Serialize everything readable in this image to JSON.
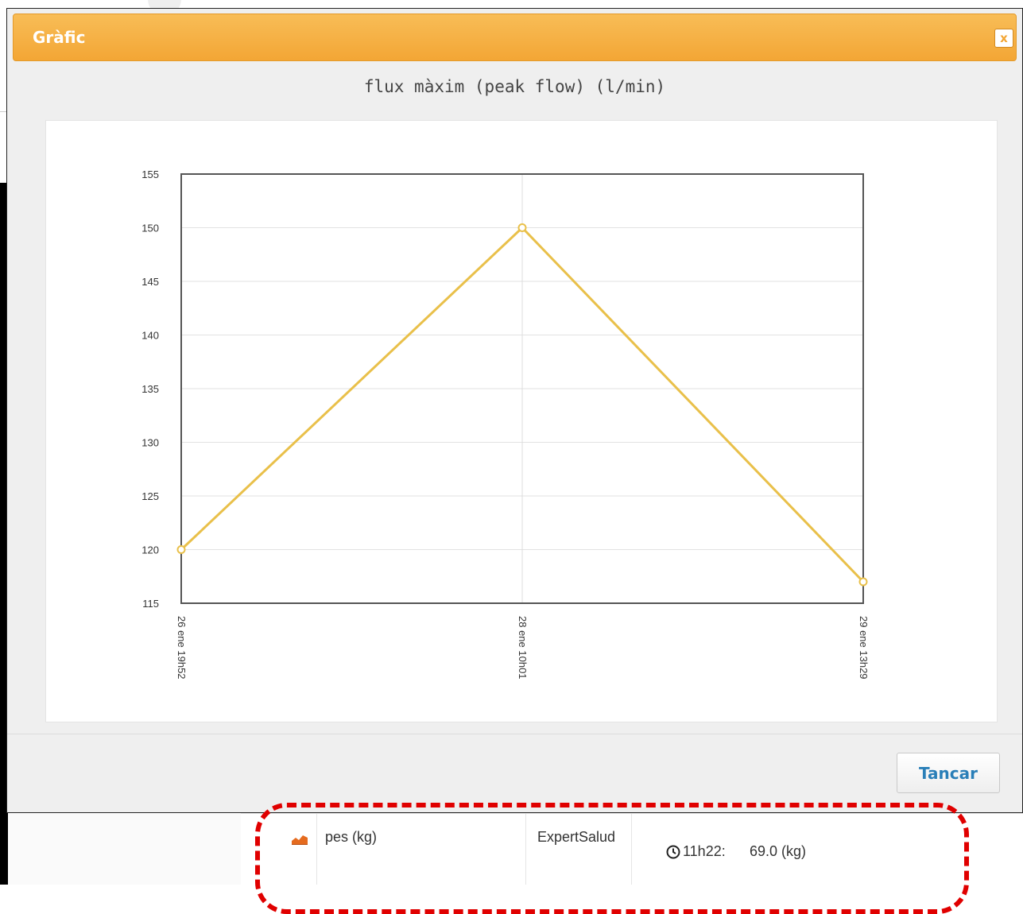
{
  "dialog": {
    "title": "Gràfic",
    "close_icon": "close-icon",
    "close_button_label": "✖",
    "close_button_label_plain": "x",
    "button_label": "Tancar"
  },
  "chart_data": {
    "type": "line",
    "title": "flux màxim (peak flow) (l/min)",
    "categories": [
      "26 ene 19h52",
      "28 ene 10h01",
      "29 ene 13h29"
    ],
    "values": [
      120,
      150,
      117
    ],
    "ylim": [
      115,
      155
    ],
    "yticks": [
      115,
      120,
      125,
      130,
      135,
      140,
      145,
      150,
      155
    ],
    "grid": true,
    "color": "#e9c04a"
  },
  "table_row": {
    "icon": "area-chart-icon",
    "name": "pes (kg)",
    "source": "ExpertSalud",
    "time": "11h22:",
    "value": "69.0 (kg)"
  },
  "colors": {
    "titlebar": "#f3a635",
    "button_text": "#2a7fb8",
    "highlight": "#e00000"
  }
}
